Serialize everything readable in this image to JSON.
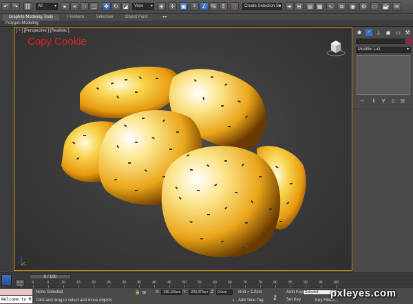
{
  "toolbar": {
    "selection_filter": "All",
    "reference_coord": "View",
    "named_selection_sets": "Create Selection Se"
  },
  "ribbon": {
    "tabs": [
      "Graphite Modeling Tools",
      "Freeform",
      "Selection",
      "Object Paint"
    ],
    "active_tab_index": 0,
    "subtab": "Polygon Modeling"
  },
  "viewport": {
    "label": "[ + ] [Perspective ] [Realistic ]",
    "title": "Copy Cookie"
  },
  "command_panel": {
    "modifier_list": "Modifier List",
    "object_color": "#b5124a"
  },
  "timeline": {
    "slider_label": "0 / 100",
    "key_button_label": "Auto Key",
    "ticks": [
      "0",
      "5",
      "10",
      "15",
      "20",
      "25",
      "30",
      "35",
      "40",
      "45",
      "50",
      "55",
      "60",
      "65",
      "70",
      "75",
      "80",
      "85",
      "90",
      "95",
      "100"
    ]
  },
  "status": {
    "listener_text": "Welcome to M",
    "selection": "None Selected",
    "prompt": "Click and drag to select and move objects",
    "x_label": "X:",
    "x_value": "-380.165cm",
    "y_label": "Y:",
    "y_value": "-223.979cm",
    "z_label": "Z:",
    "z_value": "0.0cm",
    "grid": "Grid = 1.0cm",
    "add_time_tag": "Add Time Tag",
    "auto_key": "Auto Key",
    "set_key": "Set Key",
    "selected": "Selected",
    "key_filters": "Key Filters..."
  },
  "watermark": "pxleyes.com",
  "accent_colors": {
    "viewport_border": "#e0a000",
    "title_red": "#e02020",
    "active_blue": "#3c6fc0"
  }
}
